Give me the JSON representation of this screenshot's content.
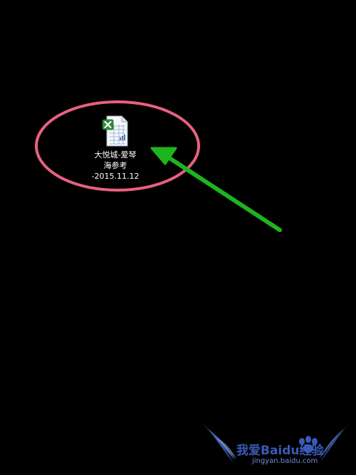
{
  "desktop": {
    "background_color": "#000000",
    "file": {
      "name_line1": "大悦城-爱琴",
      "name_line2": "海参考",
      "name_line3": "-2015.11.12",
      "icon": "excel-spreadsheet-icon"
    },
    "annotation": {
      "ellipse_color": "#e8607f",
      "arrow_color": "#1db51d"
    }
  },
  "watermark": {
    "text": "我爱Baidu经验",
    "url": "jingyan.baidu.com",
    "logo": "baidu-paw-wings-logo"
  }
}
